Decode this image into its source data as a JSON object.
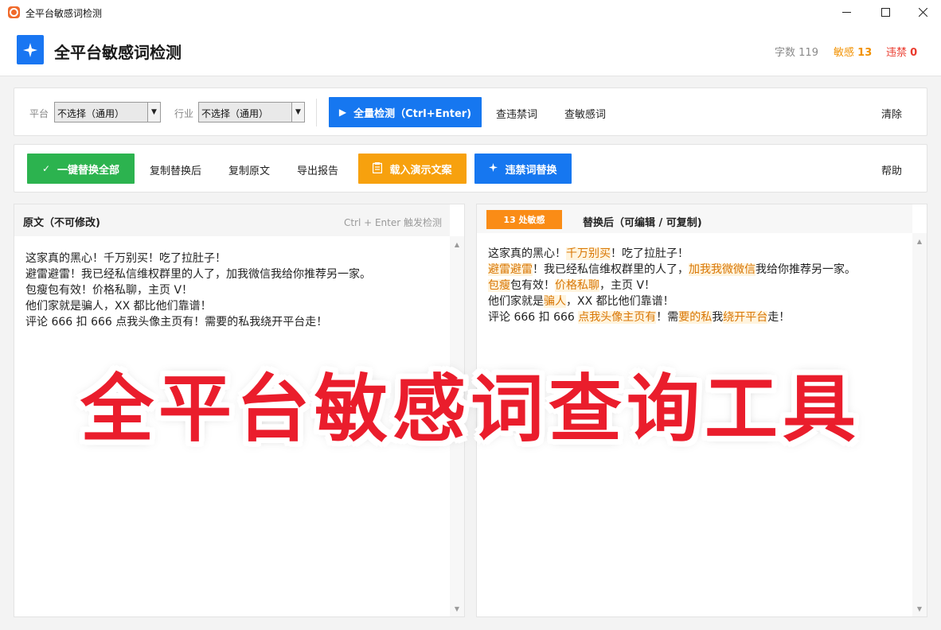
{
  "window": {
    "title": "全平台敏感词检测",
    "minimize": "—",
    "maximize": "☐",
    "close": "✕"
  },
  "header": {
    "title": "全平台敏感词检测",
    "chars_label": "字数",
    "chars_value": "119",
    "sensitive_label": "敏感",
    "sensitive_value": "13",
    "banned_label": "违禁",
    "banned_value": "0"
  },
  "toolbar1": {
    "platform_label": "平台",
    "platform_value": "不选择（通用）",
    "industry_label": "行业",
    "industry_value": "不选择（通用）",
    "detect_button": "全量检测（Ctrl+Enter)",
    "check_banned": "查违禁词",
    "check_sensitive": "查敏感词",
    "clear": "清除"
  },
  "toolbar2": {
    "replace_all": "一键替换全部",
    "copy_replaced": "复制替换后",
    "copy_original": "复制原文",
    "export_report": "导出报告",
    "load_demo": "载入演示文案",
    "banned_replace": "违禁词替换",
    "help": "帮助"
  },
  "left_editor": {
    "title": "原文（不可修改)",
    "hint": "Ctrl + Enter 触发检测",
    "lines": [
      "这家真的黑心！千万别买！吃了拉肚子！",
      "避雷避雷！我已经私信维权群里的人了，加我微信我给你推荐另一家。",
      "包瘦包有效！价格私聊，主页 V！",
      "他们家就是骗人，XX 都比他们靠谱！",
      "评论 666 扣 666 点我头像主页有！需要的私我绕开平台走！"
    ]
  },
  "right_editor": {
    "badge": "13 处敏感",
    "title": "替换后（可编辑 / 可复制)",
    "lines": [
      [
        {
          "t": "这家真的黑心！"
        },
        {
          "t": "千万别买",
          "h": true
        },
        {
          "t": "！吃了拉肚子！"
        }
      ],
      [
        {
          "t": "避雷避雷",
          "h": true
        },
        {
          "t": "！我已经私信维权群里的人了，"
        },
        {
          "t": "加我我微微信",
          "h": true
        },
        {
          "t": "我给你推荐另一家。"
        }
      ],
      [
        {
          "t": "包瘦",
          "h": true
        },
        {
          "t": "包有效！"
        },
        {
          "t": "价格私聊",
          "h": true
        },
        {
          "t": "，主页 V！"
        }
      ],
      [
        {
          "t": "他们家就是"
        },
        {
          "t": "骗人",
          "h": true
        },
        {
          "t": "，XX 都比他们靠谱！"
        }
      ],
      [
        {
          "t": "评论 666 扣 666 "
        },
        {
          "t": "点我头像主页有",
          "h": true
        },
        {
          "t": "！需"
        },
        {
          "t": "要的私",
          "h": true
        },
        {
          "t": "我"
        },
        {
          "t": "绕开平台",
          "h": true
        },
        {
          "t": "走！"
        }
      ]
    ]
  },
  "banner": "全平台敏感词查询工具"
}
